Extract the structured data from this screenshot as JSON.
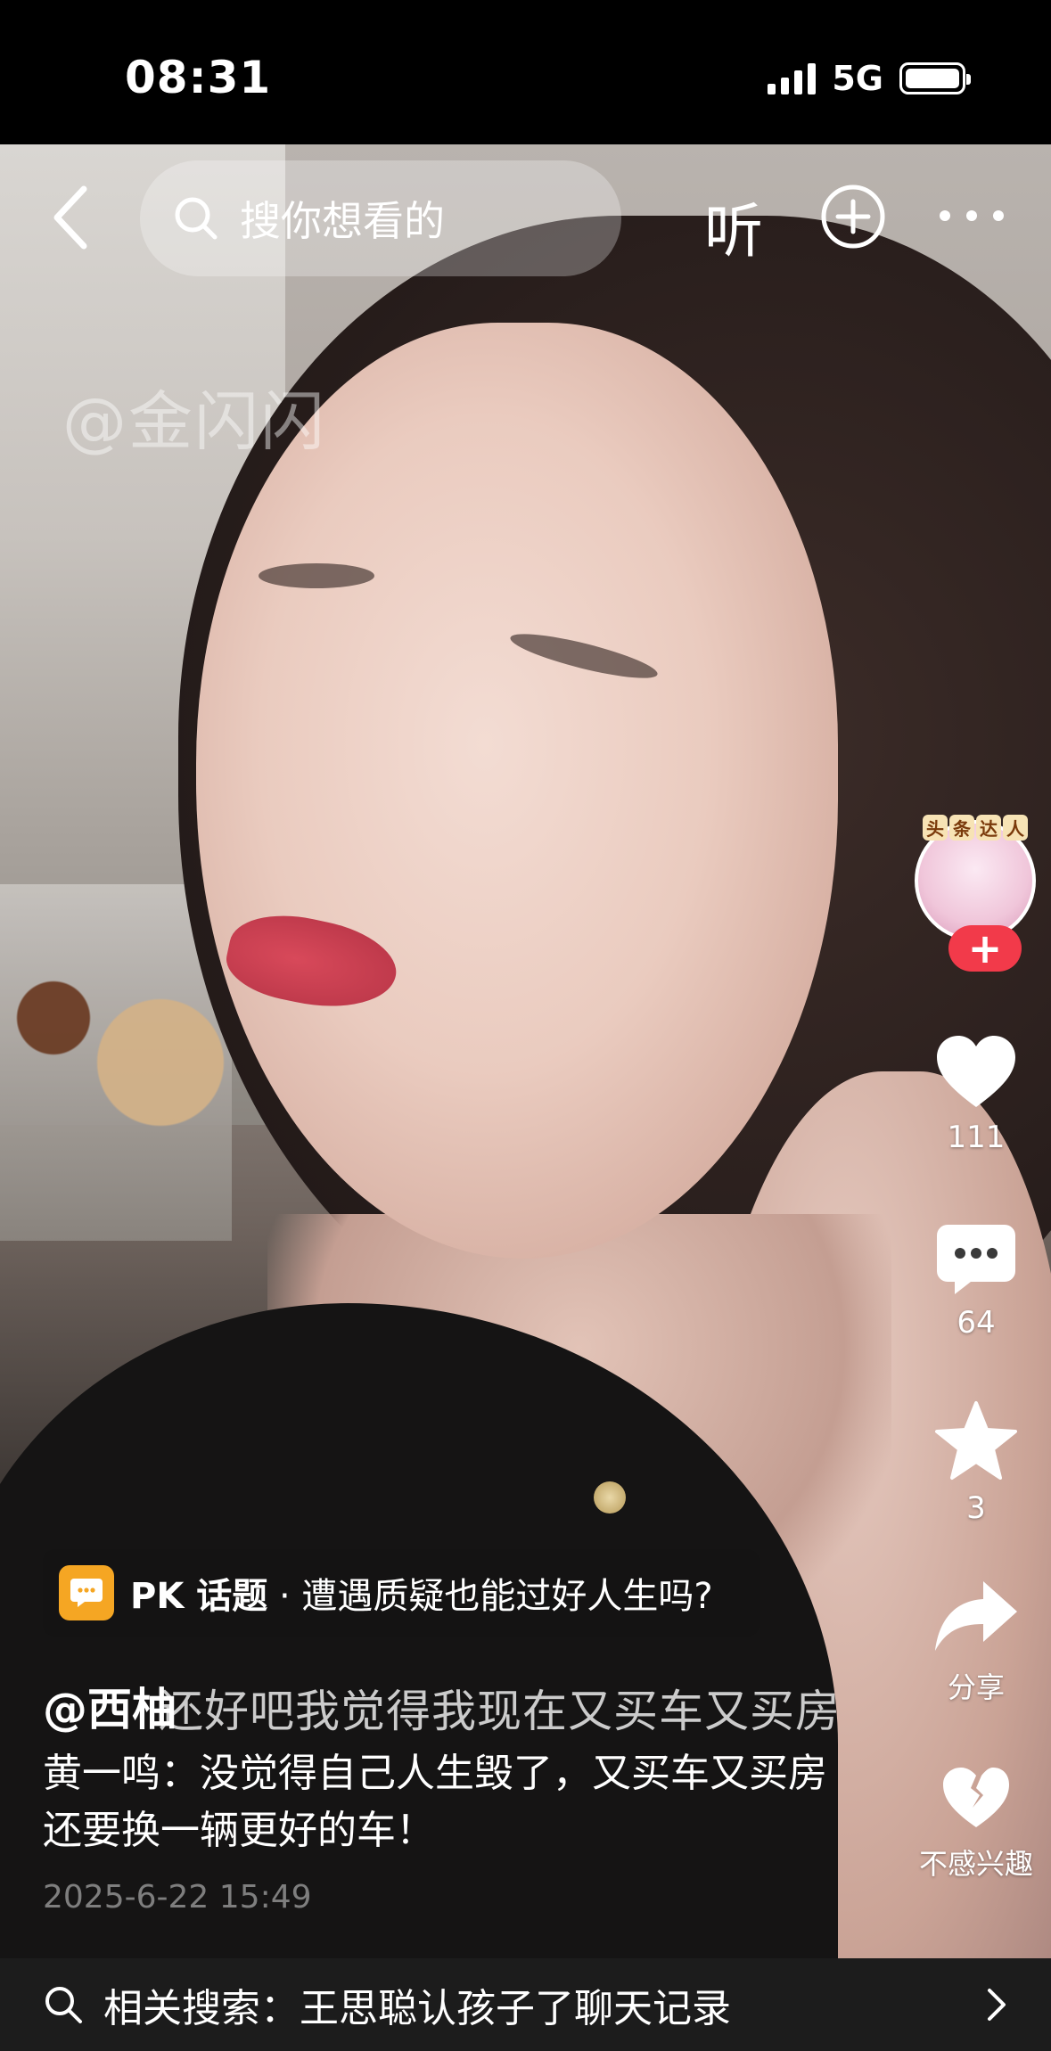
{
  "status_bar": {
    "time": "08:31",
    "network": "5G",
    "battery_level": 1.0
  },
  "top_nav": {
    "search_placeholder": "搜你想看的",
    "listen_label": "听",
    "icons": [
      "back-icon",
      "search-icon",
      "add-icon",
      "more-icon"
    ]
  },
  "video": {
    "watermark": "@金闪闪"
  },
  "author_badge": {
    "chars": [
      "头",
      "条",
      "达",
      "人"
    ]
  },
  "actions": {
    "likes": "111",
    "comments": "64",
    "favorites": "3",
    "share_label": "分享",
    "dislike_label": "不感兴趣"
  },
  "pk_topic": {
    "prefix": "PK 话题",
    "text": " · 遭遇质疑也能过好人生吗?"
  },
  "post": {
    "author": "@西柚",
    "subtitle": "还好吧我觉得我现在又买车又买房",
    "description": "黄一鸣：没觉得自己人生毁了，又买车又买房还要换一辆更好的车！",
    "timestamp": "2025-6-22 15:49"
  },
  "related_search": {
    "text": "相关搜索：王思聪认孩子了聊天记录"
  },
  "colors": {
    "follow_red": "#f23a4a",
    "pk_orange": "#f5a623"
  }
}
